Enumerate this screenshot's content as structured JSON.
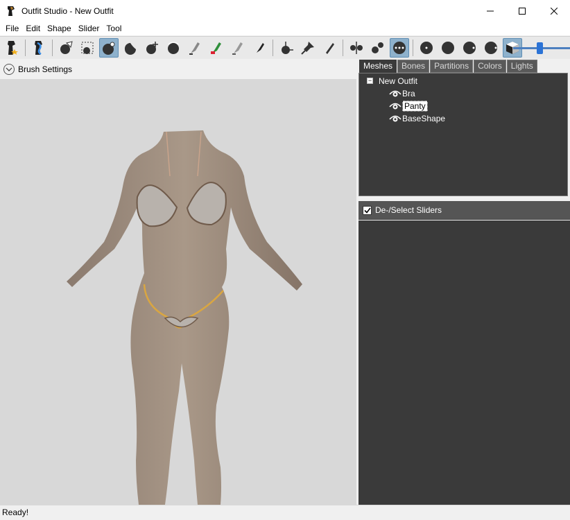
{
  "window": {
    "title": "Outfit Studio - New Outfit"
  },
  "menu": [
    "File",
    "Edit",
    "Shape",
    "Slider",
    "Tool"
  ],
  "toolbar": {
    "tools": [
      "new-project-icon",
      "load-reference-icon",
      "select-brush-icon",
      "mask-select-icon",
      "inflate-brush-icon",
      "deflate-brush-icon",
      "move-brush-icon",
      "smooth-brush-icon",
      "undiff-brush-icon",
      "weight-brush-icon",
      "color-brush-icon",
      "alpha-brush-icon",
      "transform-icon",
      "pivot-icon",
      "edit-slider-icon",
      "x-mirror-icon",
      "connected-only-icon",
      "vertex-mode-icon",
      "brush-size-1-icon",
      "brush-size-2-icon",
      "brush-size-3-icon",
      "brush-size-4-icon",
      "texture-toggle-icon"
    ],
    "zoom_slider_level": 0.48
  },
  "left_panel": {
    "brush_settings_label": "Brush Settings"
  },
  "tabs": [
    "Meshes",
    "Bones",
    "Partitions",
    "Colors",
    "Lights"
  ],
  "active_tab": "Meshes",
  "tree": {
    "root": "New Outfit",
    "children": [
      "Bra",
      "Panty",
      "BaseShape"
    ],
    "selected": "Panty"
  },
  "sliders_panel": {
    "header": "De-/Select Sliders"
  },
  "status": {
    "text": "Ready!"
  },
  "colors": {
    "accent": "#2b73d6",
    "panel_dark": "#3a3a3a",
    "viewport": "#d8d8d8"
  }
}
